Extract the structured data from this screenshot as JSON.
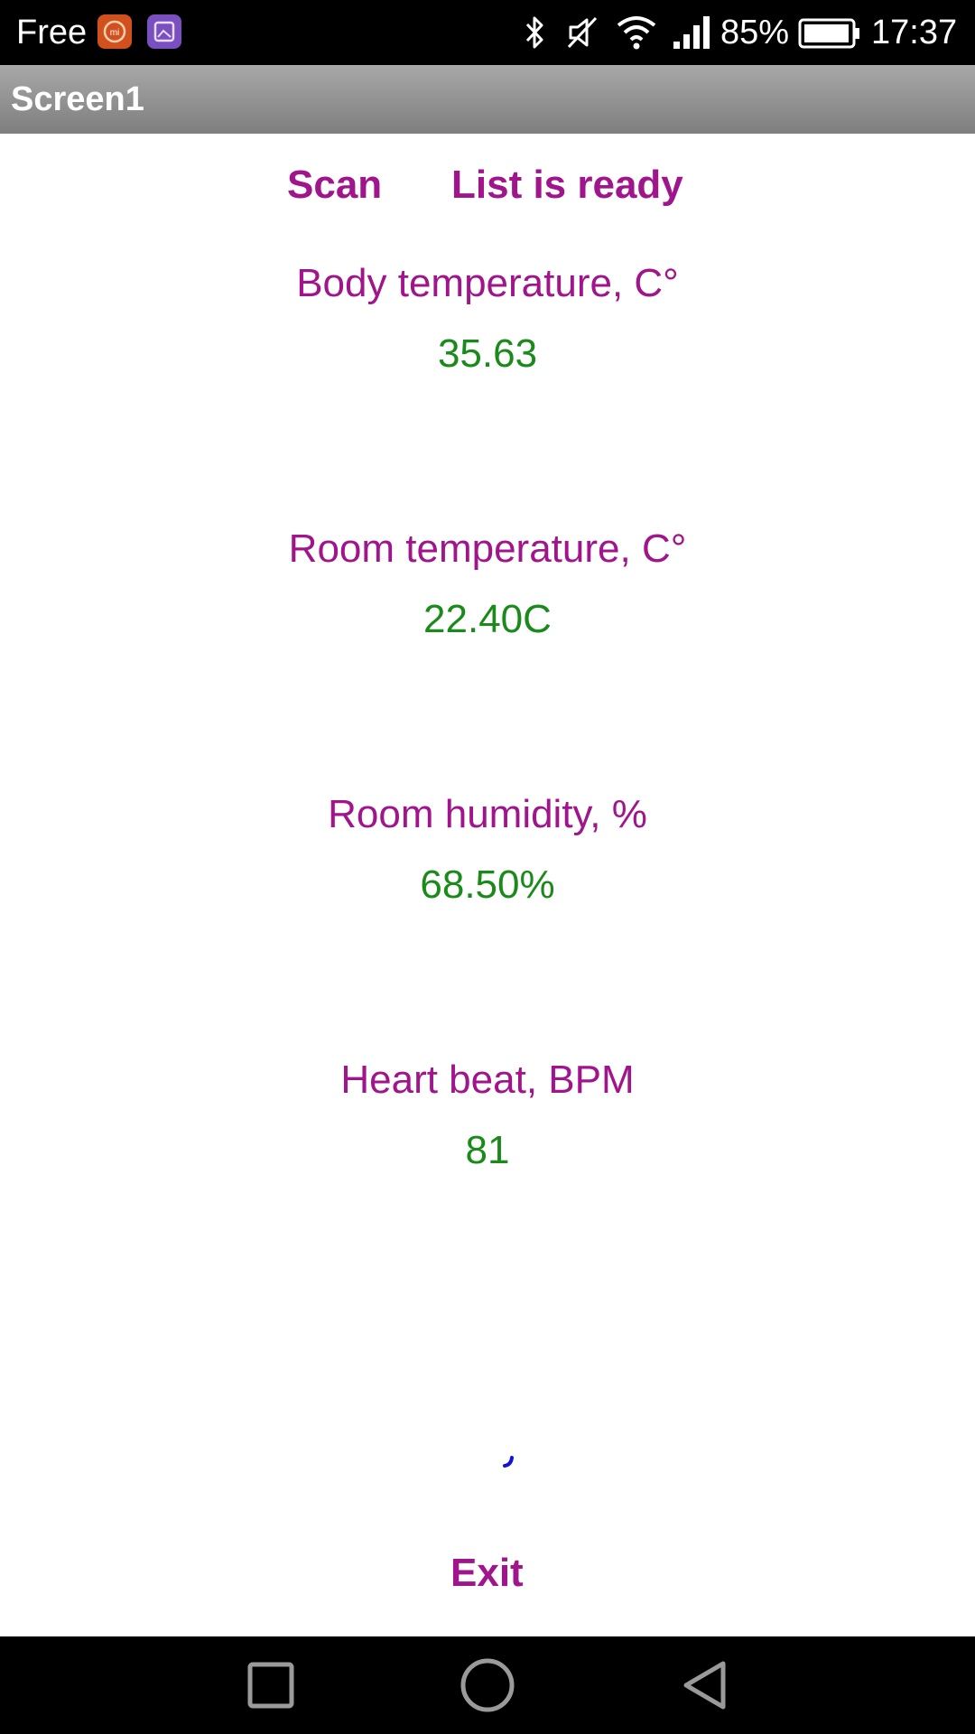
{
  "status_bar": {
    "carrier": "Free",
    "battery_percent": "85%",
    "time": "17:37",
    "icons": [
      "mi-app-icon",
      "gallery-app-icon",
      "bluetooth-icon",
      "muted-icon",
      "wifi-icon",
      "signal-icon",
      "battery-icon"
    ]
  },
  "title_bar": {
    "title": "Screen1"
  },
  "actions": {
    "scan_label": "Scan",
    "list_label": "List is ready",
    "exit_label": "Exit"
  },
  "readings": [
    {
      "label": "Body temperature, C°",
      "value": "35.63"
    },
    {
      "label": "Room temperature, C°",
      "value": "22.40C"
    },
    {
      "label": "Room humidity, %",
      "value": "68.50%"
    },
    {
      "label": "Heart beat, BPM",
      "value": "81"
    }
  ],
  "colors": {
    "label": "#a0148c",
    "value": "#1a8a1a",
    "titlebar": "#8e8e8e",
    "status_bar": "#000000"
  },
  "nav_bar": {
    "icons": [
      "recents-square-icon",
      "home-circle-icon",
      "back-triangle-icon"
    ]
  }
}
